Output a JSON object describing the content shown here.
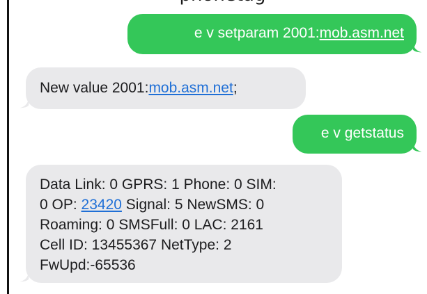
{
  "conversation": {
    "caption": "—phonetag",
    "messages": [
      {
        "direction": "outgoing",
        "prefix": "e v setparam 2001:",
        "link": "mob.asm.net",
        "suffix": ""
      },
      {
        "direction": "incoming",
        "prefix": "New value 2001:",
        "link": "mob.asm.net",
        "suffix": ";"
      },
      {
        "direction": "outgoing",
        "text": "e v getstatus"
      },
      {
        "direction": "incoming",
        "line1": "Data Link: 0 GPRS: 1 Phone: 0 SIM:",
        "line2_prefix": "0 OP: ",
        "line2_link": "23420",
        "line2_suffix": " Signal: 5 NewSMS: 0",
        "line3": "Roaming: 0 SMSFull: 0 LAC: 2161",
        "line4": "Cell ID: 13455367 NetType: 2",
        "line5": "FwUpd:-65536"
      }
    ]
  },
  "colors": {
    "outgoing_bubble": "#34c759",
    "incoming_bubble": "#e9e9eb",
    "link_in_incoming": "#1f6fd6"
  }
}
